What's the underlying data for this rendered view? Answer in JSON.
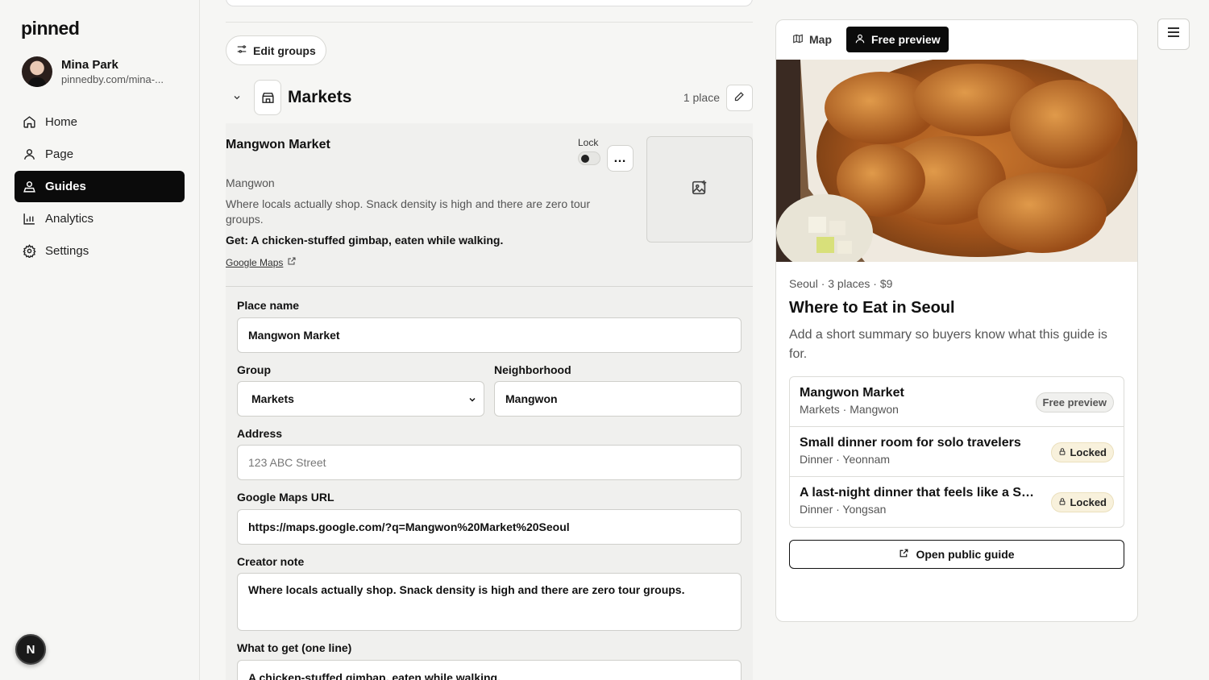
{
  "app": {
    "logo": "pinned"
  },
  "profile": {
    "name": "Mina Park",
    "url": "pinnedby.com/mina-..."
  },
  "nav": {
    "items": [
      {
        "label": "Home",
        "icon": "home-icon"
      },
      {
        "label": "Page",
        "icon": "user-icon"
      },
      {
        "label": "Guides",
        "icon": "guides-icon",
        "active": true
      },
      {
        "label": "Analytics",
        "icon": "bar-chart-icon"
      },
      {
        "label": "Settings",
        "icon": "gear-icon"
      }
    ]
  },
  "bottom_badge": "N",
  "editor": {
    "edit_groups_label": "Edit groups",
    "group": {
      "title": "Markets",
      "count": "1 place"
    },
    "place": {
      "name": "Mangwon Market",
      "lock_label": "Lock",
      "more_label": "…",
      "neighborhood": "Mangwon",
      "note": "Where locals actually shop. Snack density is high and there are zero tour groups.",
      "get": "Get: A chicken-stuffed gimbap, eaten while walking.",
      "maps_link": "Google Maps"
    },
    "form": {
      "place_name_label": "Place name",
      "place_name_value": "Mangwon Market",
      "group_label": "Group",
      "group_value": "Markets",
      "neighborhood_label": "Neighborhood",
      "neighborhood_value": "Mangwon",
      "address_label": "Address",
      "address_placeholder": "123 ABC Street",
      "maps_url_label": "Google Maps URL",
      "maps_url_value": "https://maps.google.com/?q=Mangwon%20Market%20Seoul",
      "creator_note_label": "Creator note",
      "creator_note_value": "Where locals actually shop. Snack density is high and there are zero tour groups.",
      "what_to_get_label": "What to get (one line)",
      "what_to_get_value": "A chicken-stuffed gimbap, eaten while walking."
    }
  },
  "preview": {
    "tabs": [
      {
        "label": "Map",
        "icon": "map-icon"
      },
      {
        "label": "Free preview",
        "icon": "user-icon",
        "active": true
      }
    ],
    "meta": "Seoul · 3 places · $9",
    "title": "Where to Eat in Seoul",
    "summary": "Add a short summary so buyers know what this guide is for.",
    "places": [
      {
        "title": "Mangwon Market",
        "sub": "Markets · Mangwon",
        "badge": "Free preview",
        "badge_type": "free"
      },
      {
        "title": "Small dinner room for solo travelers",
        "sub": "Dinner · Yeonnam",
        "badge": "Locked",
        "badge_type": "locked"
      },
      {
        "title": "A last-night dinner that feels like a S…",
        "sub": "Dinner · Yongsan",
        "badge": "Locked",
        "badge_type": "locked"
      }
    ],
    "open_label": "Open public guide"
  },
  "colors": {
    "primary": "#0b0b0b",
    "locked_bg": "#f8f1dc",
    "surface": "#f6f6f4"
  }
}
